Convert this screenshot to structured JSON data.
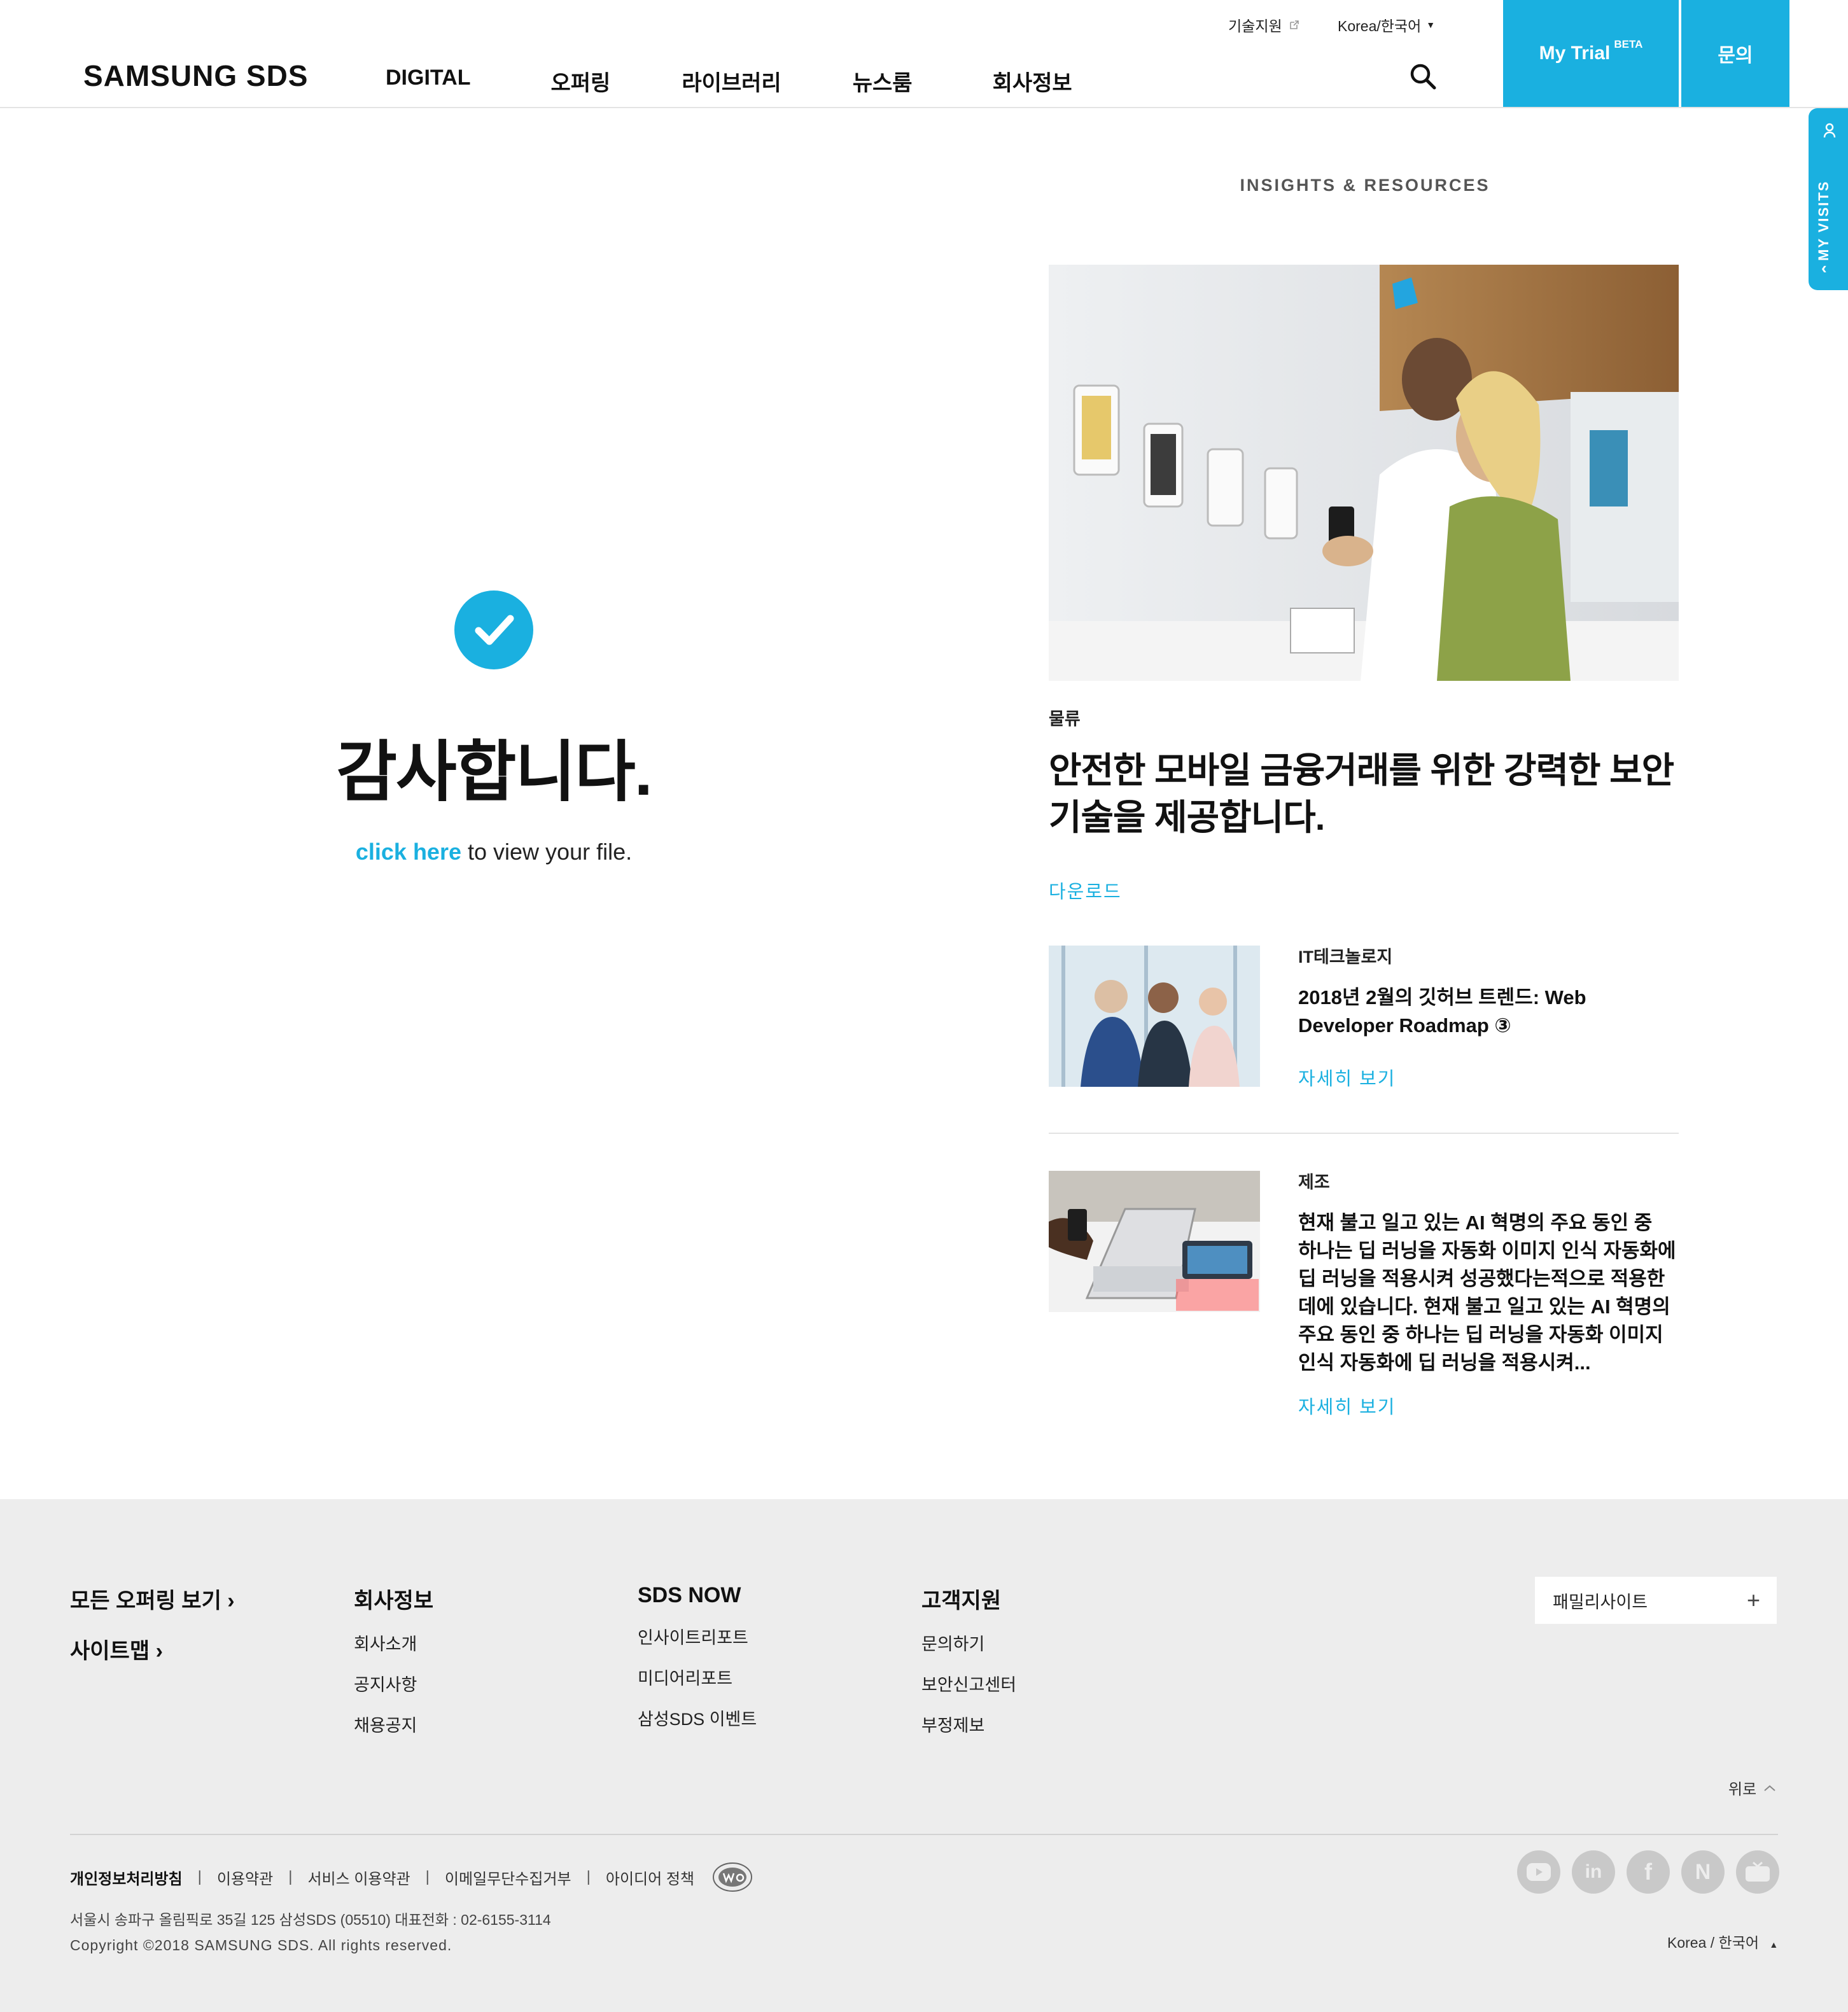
{
  "header": {
    "logo": "SAMSUNG SDS",
    "util": {
      "tech_support": "기술지원",
      "language": "Korea/한국어"
    },
    "nav": [
      "DIGITAL",
      "오퍼링",
      "라이브러리",
      "뉴스룸",
      "회사정보"
    ],
    "my_trial": "My Trial",
    "my_trial_badge": "BETA",
    "contact": "문의",
    "my_visits": "MY VISITS"
  },
  "thanks": {
    "title": "감사합니다.",
    "link": "click here",
    "suffix": " to view your file."
  },
  "insights": {
    "heading": "INSIGHTS & RESOURCES",
    "featured": {
      "category": "물류",
      "title_line1": "안전한 모바일 금융거래를 위한 강력한 보안",
      "title_line2": "기술을 제공합니다.",
      "link": "다운로드"
    },
    "items": [
      {
        "category": "IT테크놀로지",
        "title_line1": "2018년 2월의 깃허브 트렌드: Web",
        "title_line2": "Developer Roadmap ③",
        "link": "자세히 보기"
      },
      {
        "category": "제조",
        "lines": [
          "현재 불고 일고 있는 AI 혁명의 주요 동인 중",
          "하나는 딥 러닝을 자동화 이미지 인식 자동화에",
          "딥 러닝을 적용시켜 성공했다는적으로 적용한",
          "데에 있습니다. 현재 불고 일고 있는 AI 혁명의",
          "주요 동인 중 하나는 딥 러닝을 자동화 이미지",
          "인식 자동화에 딥 러닝을 적용시켜..."
        ],
        "link": "자세히 보기"
      }
    ]
  },
  "footer": {
    "quick": {
      "all_offerings": "모든 오퍼링 보기",
      "sitemap": "사이트맵"
    },
    "cols": [
      {
        "head": "회사정보",
        "links": [
          "회사소개",
          "공지사항",
          "채용공지"
        ]
      },
      {
        "head": "SDS NOW",
        "links": [
          "인사이트리포트",
          "미디어리포트",
          "삼성SDS 이벤트"
        ]
      },
      {
        "head": "고객지원",
        "links": [
          "문의하기",
          "보안신고센터",
          "부정제보"
        ]
      }
    ],
    "family_site": "패밀리사이트",
    "top": "위로",
    "policies": [
      "개인정보처리방침",
      "이용약관",
      "서비스 이용약관",
      "이메일무단수집거부",
      "아이디어 정책"
    ],
    "address": "서울시 송파구 올림픽로 35길 125 삼성SDS (05510)   대표전화 : 02-6155-3114",
    "copyright": "Copyright ©2018 SAMSUNG SDS. All rights reserved.",
    "socials": [
      "youtube-icon",
      "linkedin-icon",
      "facebook-icon",
      "naver-icon",
      "news-icon"
    ],
    "language": "Korea / 한국어"
  },
  "colors": {
    "accent": "#1ab0e0",
    "footer_bg": "#ededed"
  }
}
